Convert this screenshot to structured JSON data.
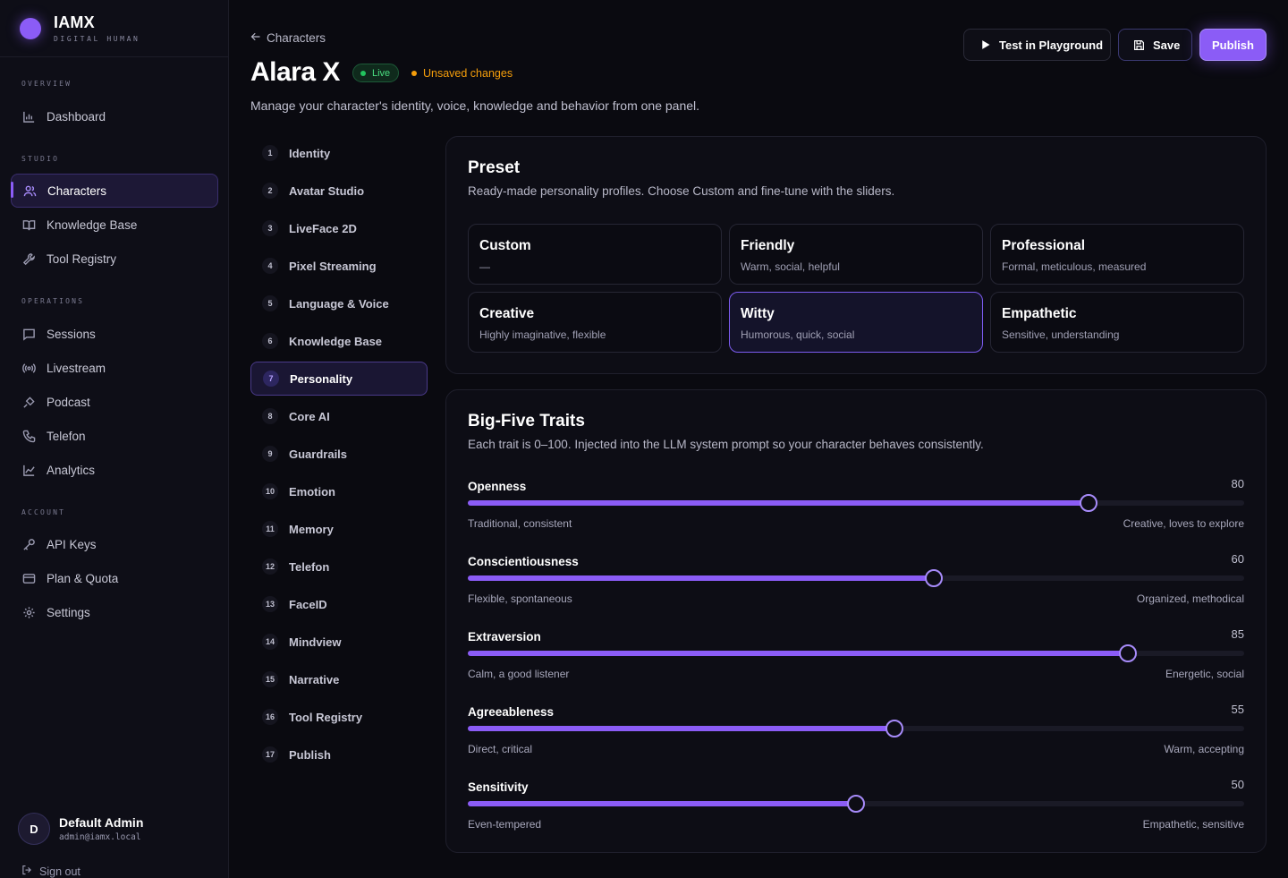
{
  "brand": {
    "name": "IAMX",
    "tagline": "DIGITAL HUMAN"
  },
  "sidebar": {
    "sections": [
      {
        "label": "OVERVIEW",
        "items": [
          {
            "label": "Dashboard",
            "icon": "bar-chart-icon"
          }
        ]
      },
      {
        "label": "STUDIO",
        "items": [
          {
            "label": "Characters",
            "icon": "users-icon",
            "active": true
          },
          {
            "label": "Knowledge Base",
            "icon": "book-icon"
          },
          {
            "label": "Tool Registry",
            "icon": "wrench-icon"
          }
        ]
      },
      {
        "label": "OPERATIONS",
        "items": [
          {
            "label": "Sessions",
            "icon": "chat-icon"
          },
          {
            "label": "Livestream",
            "icon": "broadcast-icon"
          },
          {
            "label": "Podcast",
            "icon": "mic-icon"
          },
          {
            "label": "Telefon",
            "icon": "phone-icon"
          },
          {
            "label": "Analytics",
            "icon": "line-chart-icon"
          }
        ]
      },
      {
        "label": "ACCOUNT",
        "items": [
          {
            "label": "API Keys",
            "icon": "key-icon"
          },
          {
            "label": "Plan & Quota",
            "icon": "card-icon"
          },
          {
            "label": "Settings",
            "icon": "gear-icon"
          }
        ]
      }
    ]
  },
  "user": {
    "initial": "D",
    "name": "Default Admin",
    "email": "admin@iamx.local",
    "signout": "Sign out"
  },
  "header": {
    "back": "Characters",
    "title": "Alara X",
    "status": "Live",
    "unsaved": "Unsaved changes",
    "subtitle": "Manage your character's identity, voice, knowledge and behavior from one panel.",
    "test_label": "Test in Playground",
    "save_label": "Save",
    "publish_label": "Publish"
  },
  "steps": [
    {
      "n": "1",
      "label": "Identity"
    },
    {
      "n": "2",
      "label": "Avatar Studio"
    },
    {
      "n": "3",
      "label": "LiveFace 2D"
    },
    {
      "n": "4",
      "label": "Pixel Streaming"
    },
    {
      "n": "5",
      "label": "Language & Voice"
    },
    {
      "n": "6",
      "label": "Knowledge Base"
    },
    {
      "n": "7",
      "label": "Personality",
      "active": true
    },
    {
      "n": "8",
      "label": "Core AI"
    },
    {
      "n": "9",
      "label": "Guardrails"
    },
    {
      "n": "10",
      "label": "Emotion"
    },
    {
      "n": "11",
      "label": "Memory"
    },
    {
      "n": "12",
      "label": "Telefon"
    },
    {
      "n": "13",
      "label": "FaceID"
    },
    {
      "n": "14",
      "label": "Mindview"
    },
    {
      "n": "15",
      "label": "Narrative"
    },
    {
      "n": "16",
      "label": "Tool Registry"
    },
    {
      "n": "17",
      "label": "Publish"
    }
  ],
  "preset": {
    "title": "Preset",
    "description": "Ready-made personality profiles. Choose Custom and fine-tune with the sliders.",
    "options": [
      {
        "name": "Custom",
        "desc": "—"
      },
      {
        "name": "Friendly",
        "desc": "Warm, social, helpful"
      },
      {
        "name": "Professional",
        "desc": "Formal, meticulous, measured"
      },
      {
        "name": "Creative",
        "desc": "Highly imaginative, flexible"
      },
      {
        "name": "Witty",
        "desc": "Humorous, quick, social",
        "selected": true
      },
      {
        "name": "Empathetic",
        "desc": "Sensitive, understanding"
      }
    ]
  },
  "traits": {
    "title": "Big-Five Traits",
    "description": "Each trait is 0–100. Injected into the LLM system prompt so your character behaves consistently.",
    "items": [
      {
        "name": "Openness",
        "value": 80,
        "low": "Traditional, consistent",
        "high": "Creative, loves to explore"
      },
      {
        "name": "Conscientiousness",
        "value": 60,
        "low": "Flexible, spontaneous",
        "high": "Organized, methodical"
      },
      {
        "name": "Extraversion",
        "value": 85,
        "low": "Calm, a good listener",
        "high": "Energetic, social"
      },
      {
        "name": "Agreeableness",
        "value": 55,
        "low": "Direct, critical",
        "high": "Warm, accepting"
      },
      {
        "name": "Sensitivity",
        "value": 50,
        "low": "Even-tempered",
        "high": "Empathetic, sensitive"
      }
    ]
  },
  "colors": {
    "accent": "#8b5cf6",
    "live": "#22c55e",
    "warning": "#f59e0b"
  }
}
